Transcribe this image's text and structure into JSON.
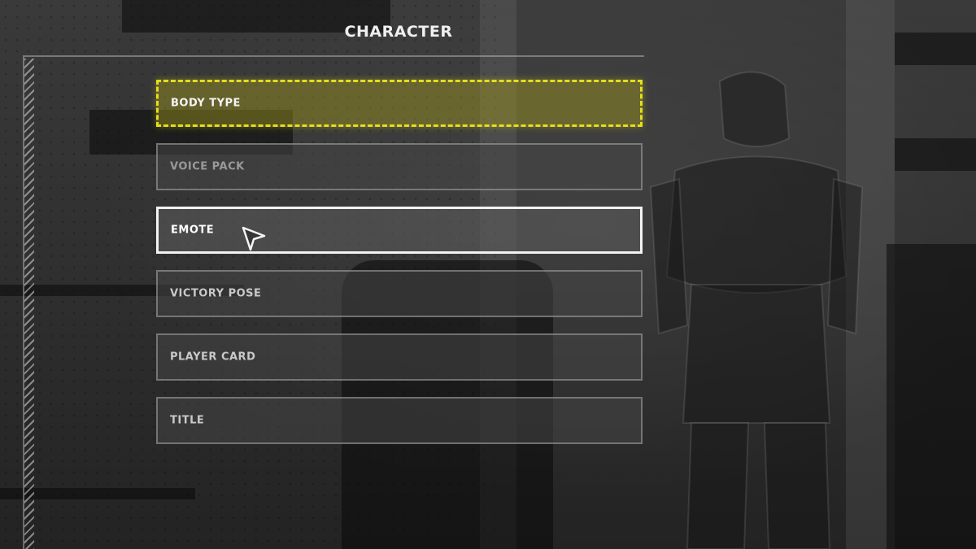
{
  "header": {
    "title": "CHARACTER"
  },
  "menu": {
    "items": [
      {
        "label": "BODY TYPE",
        "state": "selected"
      },
      {
        "label": "VOICE PACK",
        "state": "normal"
      },
      {
        "label": "EMOTE",
        "state": "hover"
      },
      {
        "label": "VICTORY POSE",
        "state": "normal"
      },
      {
        "label": "PLAYER CARD",
        "state": "normal"
      },
      {
        "label": "TITLE",
        "state": "normal"
      }
    ]
  },
  "cursor": {
    "icon": "pointer-arrow-icon"
  },
  "colors": {
    "accent_selected": "#e4dd1d",
    "hover_border": "#f2f2f2",
    "item_border": "#bebebe",
    "text": "#c9c9c9"
  }
}
